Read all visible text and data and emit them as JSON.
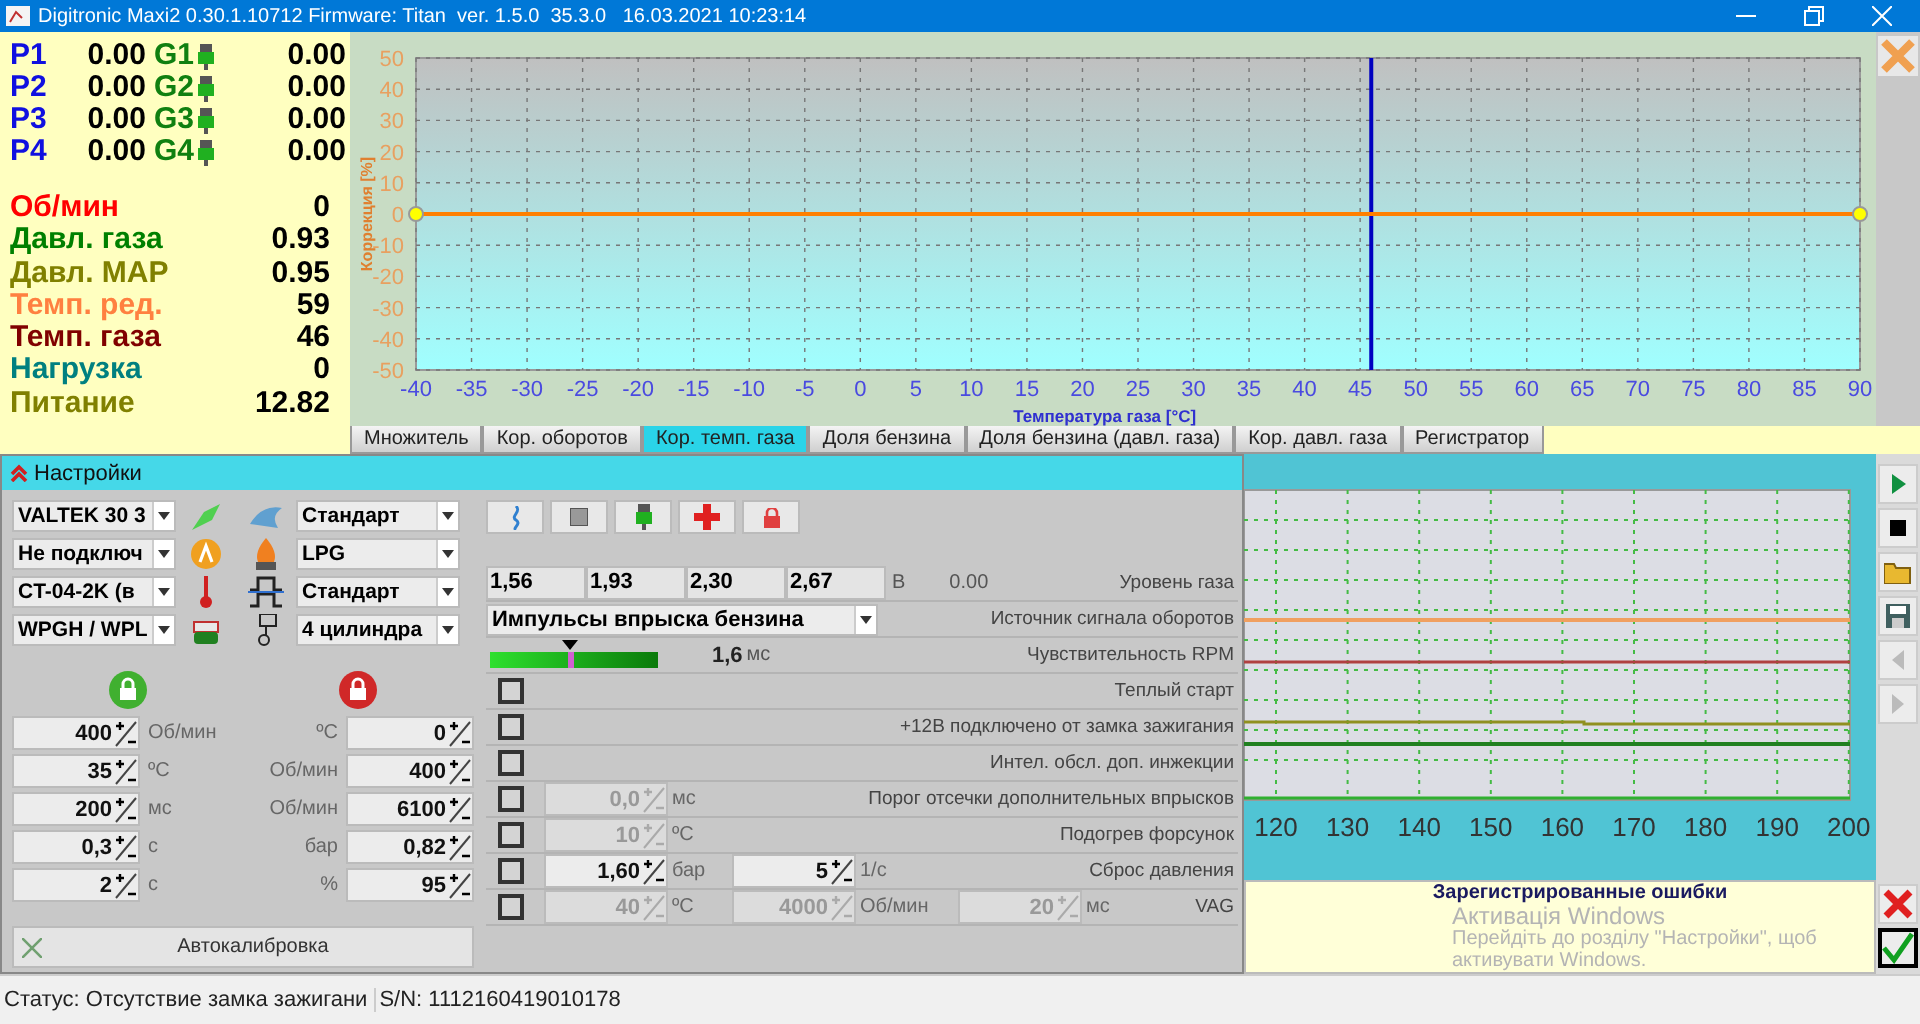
{
  "window": {
    "title": "Digitronic Maxi2 0.30.1.10712 Firmware: Titan  ver. 1.5.0  35.3.0   16.03.2021 10:23:14"
  },
  "injectors": [
    {
      "petrol": "P1",
      "petrol_value": "0.00",
      "gas": "G1",
      "gas_value": "0.00"
    },
    {
      "petrol": "P2",
      "petrol_value": "0.00",
      "gas": "G2",
      "gas_value": "0.00"
    },
    {
      "petrol": "P3",
      "petrol_value": "0.00",
      "gas": "G3",
      "gas_value": "0.00"
    },
    {
      "petrol": "P4",
      "petrol_value": "0.00",
      "gas": "G4",
      "gas_value": "0.00"
    }
  ],
  "readings": [
    {
      "label": "Об/мин",
      "value": "0",
      "color": "#ff0000"
    },
    {
      "label": "Давл. газа",
      "value": "0.93",
      "color": "#008000"
    },
    {
      "label": "Давл. MAP",
      "value": "0.95",
      "color": "#808000"
    },
    {
      "label": "Темп. ред.",
      "value": "59",
      "color": "#ff8040"
    },
    {
      "label": "Темп. газа",
      "value": "46",
      "color": "#800000"
    },
    {
      "label": "Нагрузка",
      "value": "0",
      "color": "#008080"
    },
    {
      "label": "Питание",
      "value": "12.82",
      "color": "#808000"
    }
  ],
  "correction_chart": {
    "chart_data": {
      "type": "line",
      "xlabel": "Температура газа [°C]",
      "ylabel": "Коррекция [%]",
      "x": [
        -40,
        90
      ],
      "series": [
        {
          "color": "#ff8000",
          "marker": "circle",
          "values": [
            0,
            0
          ]
        }
      ],
      "grid": true,
      "xlim": [
        -40,
        90
      ],
      "ylim": [
        -50,
        50
      ],
      "xticks": [
        -40,
        -35,
        -30,
        -25,
        -20,
        -15,
        -10,
        -5,
        0,
        5,
        10,
        15,
        20,
        25,
        30,
        35,
        40,
        45,
        50,
        55,
        60,
        65,
        70,
        75,
        80,
        85,
        90
      ],
      "yticks": [
        -50,
        -40,
        -30,
        -20,
        -10,
        0,
        10,
        20,
        30,
        40,
        50
      ],
      "ref_lines": [
        {
          "axis": "x",
          "value": 46,
          "color": "#0000c0"
        }
      ]
    }
  },
  "tabs": [
    {
      "label": "Множитель",
      "selected": false
    },
    {
      "label": "Кор. оборотов",
      "selected": false
    },
    {
      "label": "Кор. темп. газа",
      "selected": true
    },
    {
      "label": "Доля бензина",
      "selected": false
    },
    {
      "label": "Доля бензина (давл. газа)",
      "selected": false
    },
    {
      "label": "Кор. давл. газа",
      "selected": false
    },
    {
      "label": "Регистратор",
      "selected": false
    }
  ],
  "settings": {
    "title": "Настройки",
    "left_selects": [
      "VALTEK 30 3",
      "Не подключ",
      "CT-04-2K (в",
      "WPGH / WPL"
    ],
    "right_selects": [
      "Стандарт",
      "LPG",
      "Стандарт",
      "4 цилиндра"
    ],
    "on_limits": [
      {
        "value": "400",
        "unit": "Об/мин"
      },
      {
        "value": "35",
        "unit": "ºC"
      },
      {
        "value": "200",
        "unit": "мс"
      },
      {
        "value": "0,3",
        "unit": "с"
      },
      {
        "value": "2",
        "unit": "с"
      }
    ],
    "off_limits": [
      {
        "unit": "ºC",
        "value": "0"
      },
      {
        "unit": "Об/мин",
        "value": "400"
      },
      {
        "unit": "Об/мин",
        "value": "6100"
      },
      {
        "unit": "бар",
        "value": "0,82"
      },
      {
        "unit": "%",
        "value": "95"
      }
    ],
    "autocalibration": "Автокалибровка",
    "gas_level": {
      "thresholds": [
        "1,56",
        "1,93",
        "2,30",
        "2,67"
      ],
      "unit": "В",
      "reading": "0.00",
      "label": "Уровень газа"
    },
    "rpm_source": {
      "value": "Импульсы впрыска бензина",
      "label": "Источник сигнала оборотов"
    },
    "rpm_sensitivity": {
      "level": 0.48,
      "reading": "1,6",
      "unit": "мс",
      "label": "Чувствительность RPM"
    },
    "options": [
      {
        "checked": false,
        "label": "Теплый старт"
      },
      {
        "checked": false,
        "label": "+12В подключено от замка зажигания"
      },
      {
        "checked": false,
        "label": "Интел. обсл. доп. инжекции"
      },
      {
        "checked": false,
        "label": "Порог отсечки дополнительных впрысков",
        "fields": [
          {
            "value": "0,0",
            "unit": "мс",
            "disabled": true
          }
        ]
      },
      {
        "checked": false,
        "label": "Подогрев форсунок",
        "fields": [
          {
            "value": "10",
            "unit": "ºC",
            "disabled": true
          }
        ]
      },
      {
        "checked": false,
        "label": "Сброс давления",
        "fields": [
          {
            "value": "1,60",
            "unit": "бар",
            "disabled": false
          },
          {
            "value": "5",
            "unit": "1/с",
            "disabled": false
          }
        ]
      },
      {
        "checked": false,
        "label": "VAG",
        "fields": [
          {
            "value": "40",
            "unit": "ºC",
            "disabled": true
          },
          {
            "value": "4000",
            "unit": "Об/мин",
            "disabled": true
          },
          {
            "value": "20",
            "unit": "мс",
            "disabled": true
          }
        ]
      }
    ]
  },
  "logger": {
    "x_labels": [
      "120",
      "130",
      "140",
      "150",
      "160",
      "170",
      "180",
      "190",
      "200"
    ]
  },
  "errors": {
    "title": "Зарегистрированные ошибки"
  },
  "activation": {
    "title": "Активація Windows",
    "text": "Перейдіть до розділу \"Настройки\", щоб активувати Windows."
  },
  "status_bar": {
    "status": "Статус: Отсутствие замка зажигани",
    "serial": "S/N: 1112160419010178"
  }
}
